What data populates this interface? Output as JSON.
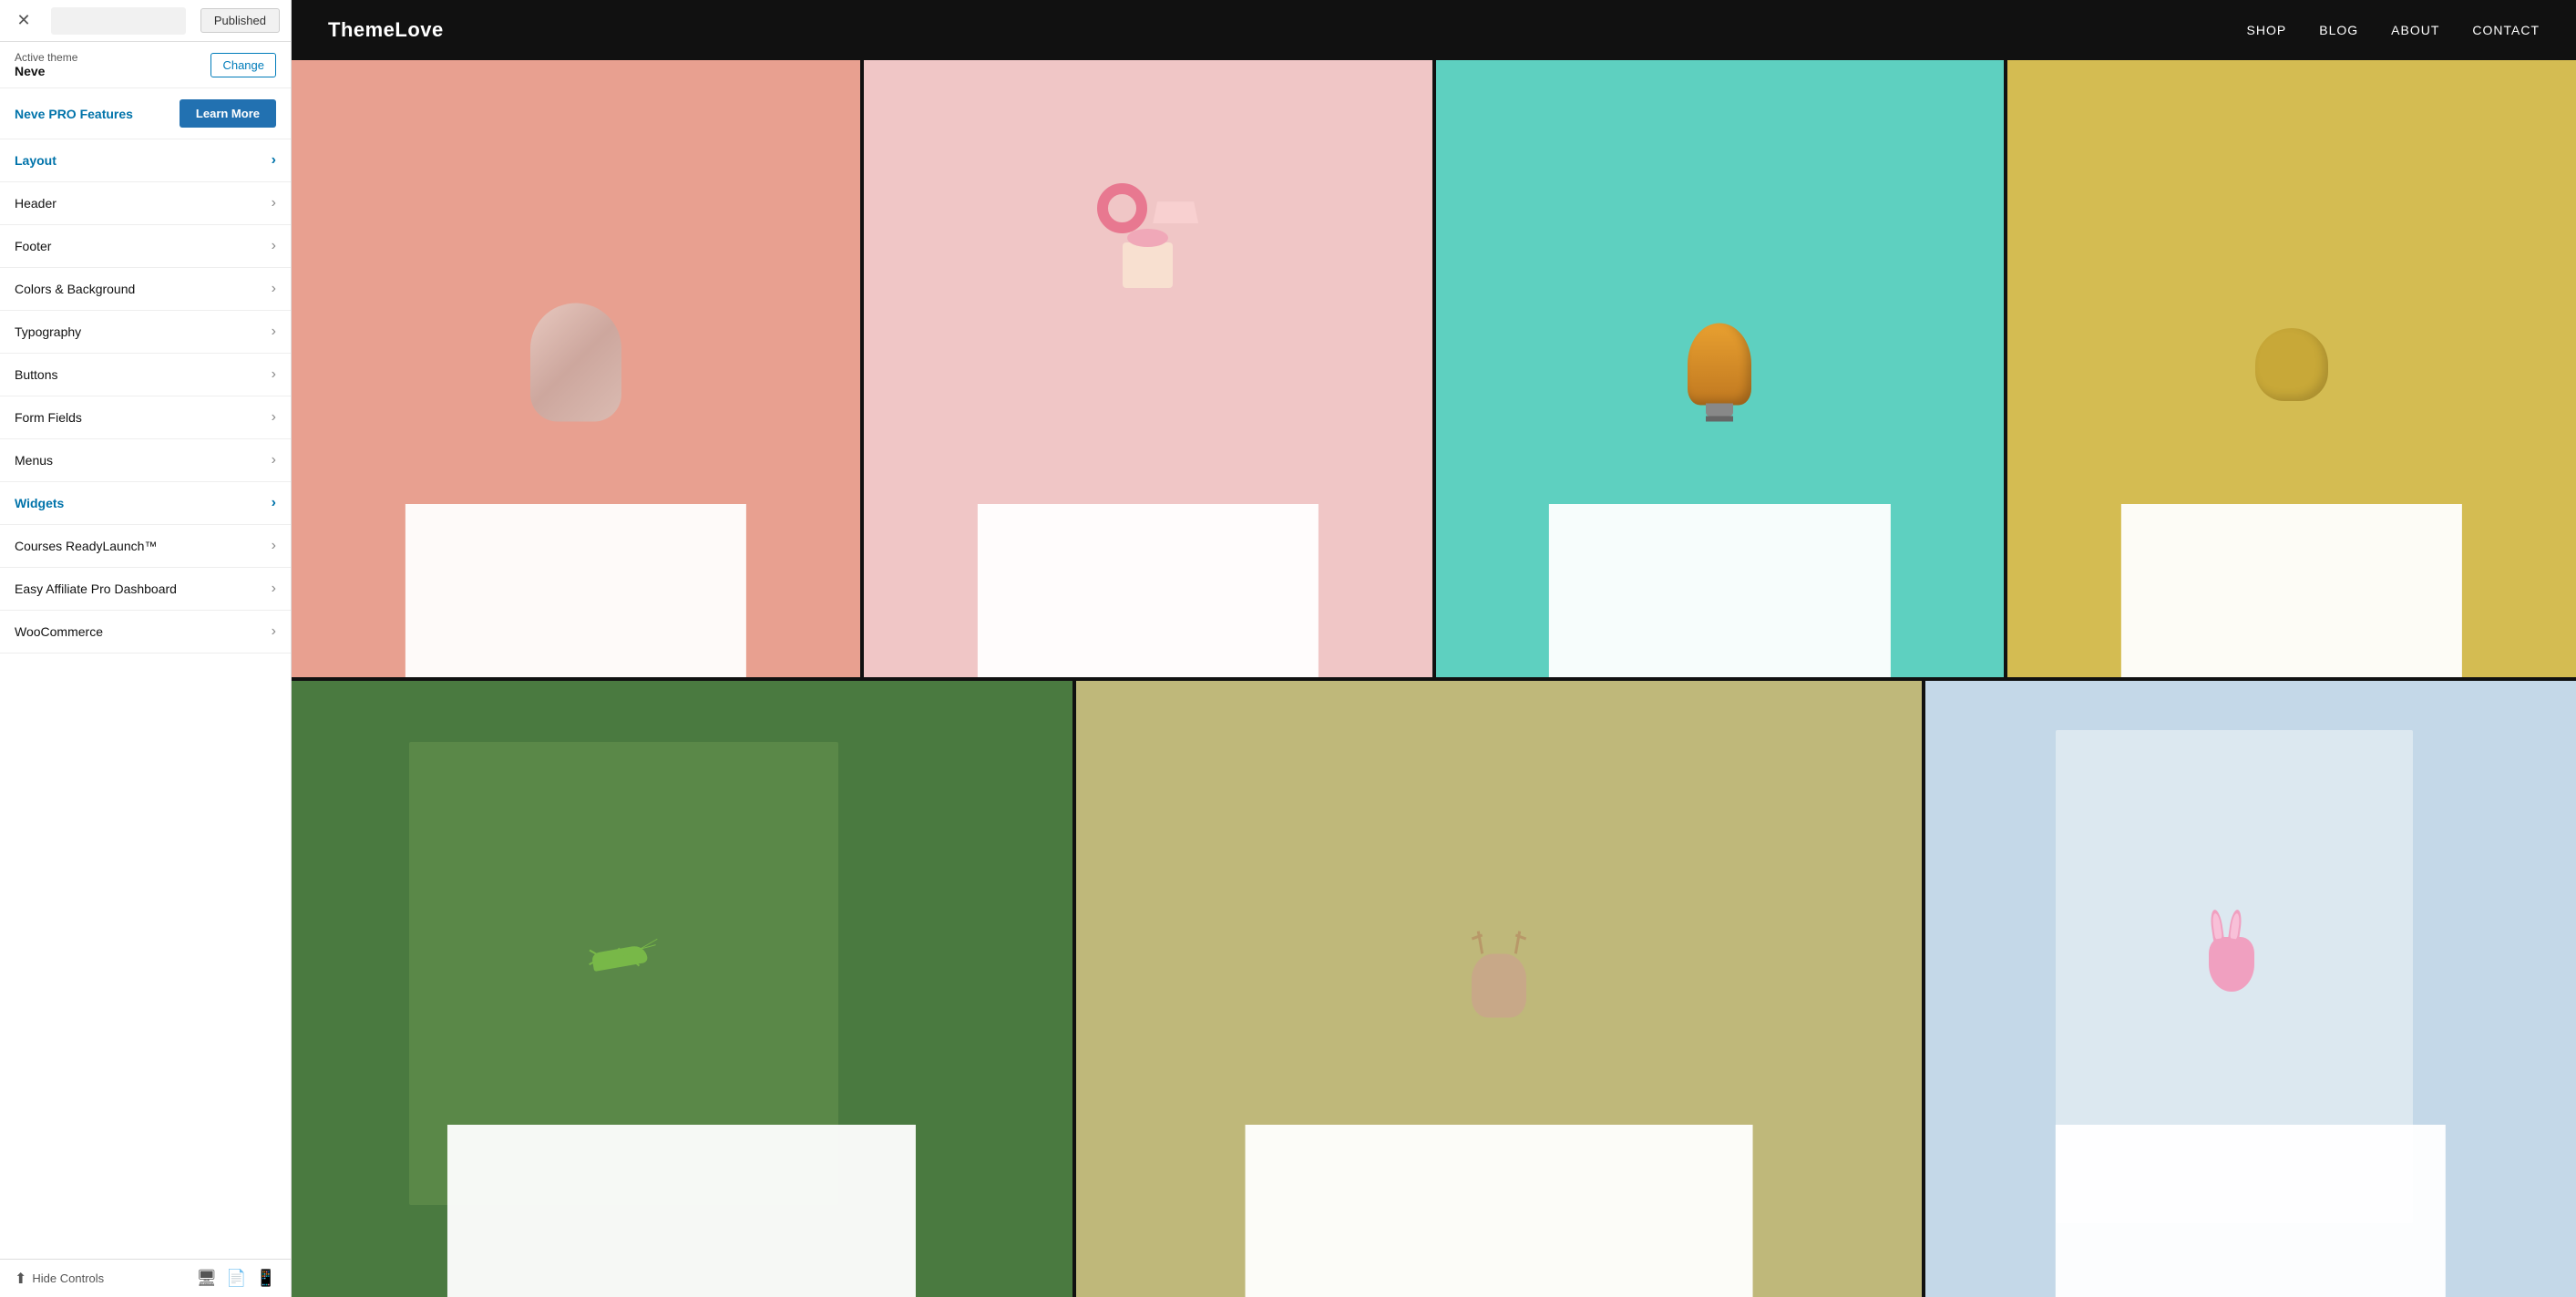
{
  "topBar": {
    "publishedLabel": "Published"
  },
  "activeTheme": {
    "label": "Active theme",
    "name": "Neve",
    "changeLabel": "Change"
  },
  "nevePro": {
    "featuresLabel": "Neve PRO Features",
    "learnMoreLabel": "Learn More"
  },
  "navItems": [
    {
      "label": "Layout",
      "active": true
    },
    {
      "label": "Header",
      "active": false
    },
    {
      "label": "Footer",
      "active": false
    },
    {
      "label": "Colors & Background",
      "active": false
    },
    {
      "label": "Typography",
      "active": false
    },
    {
      "label": "Buttons",
      "active": false
    },
    {
      "label": "Form Fields",
      "active": false
    },
    {
      "label": "Menus",
      "active": false
    },
    {
      "label": "Widgets",
      "active": true
    },
    {
      "label": "Courses ReadyLaunch™",
      "active": false
    },
    {
      "label": "Easy Affiliate Pro Dashboard",
      "active": false
    },
    {
      "label": "WooCommerce",
      "active": false
    }
  ],
  "bottomBar": {
    "hideControlsLabel": "Hide Controls"
  },
  "siteHeader": {
    "logo": "ThemeLove",
    "navItems": [
      "SHOP",
      "BLOG",
      "ABOUT",
      "CONTACT"
    ]
  }
}
